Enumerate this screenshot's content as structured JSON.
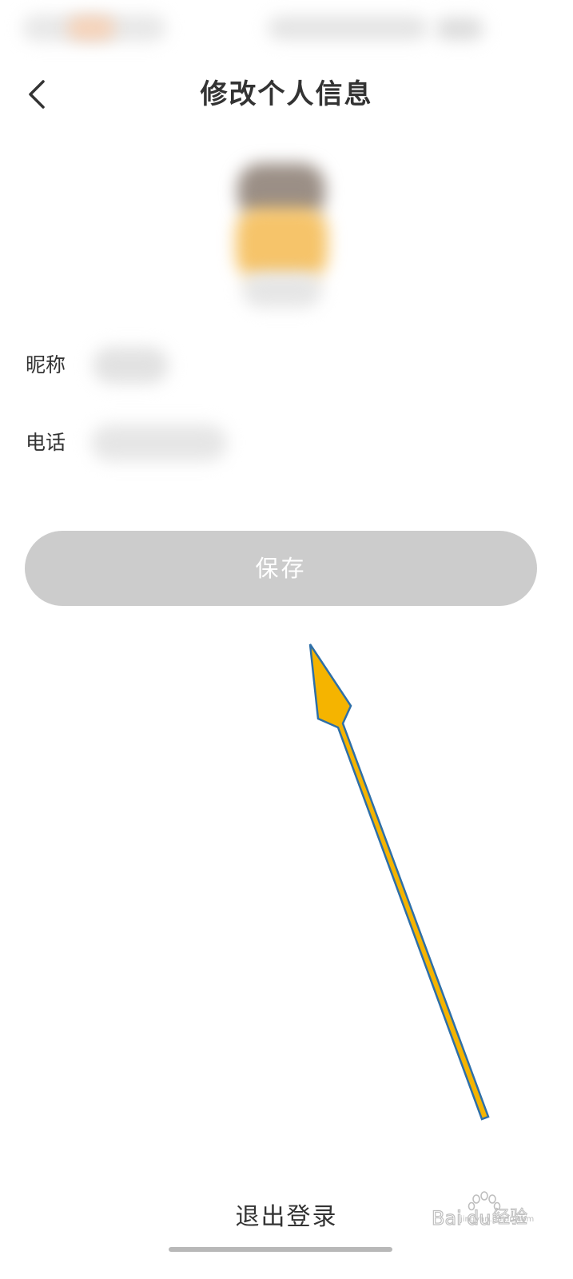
{
  "header": {
    "title": "修改个人信息",
    "back_icon": "chevron-left-icon"
  },
  "form": {
    "fields": [
      {
        "label": "昵称",
        "value": ""
      },
      {
        "label": "电话",
        "value": ""
      }
    ]
  },
  "save_button": {
    "label": "保存",
    "background": "#cccccc",
    "text_color": "#ffffff"
  },
  "logout": {
    "label": "退出登录"
  },
  "annotation": {
    "arrow_fill": "#f5b400",
    "arrow_stroke": "#2e6fa8"
  },
  "watermark": {
    "text": "Baidu经验",
    "subtext": "jingyan.baidu.com"
  }
}
